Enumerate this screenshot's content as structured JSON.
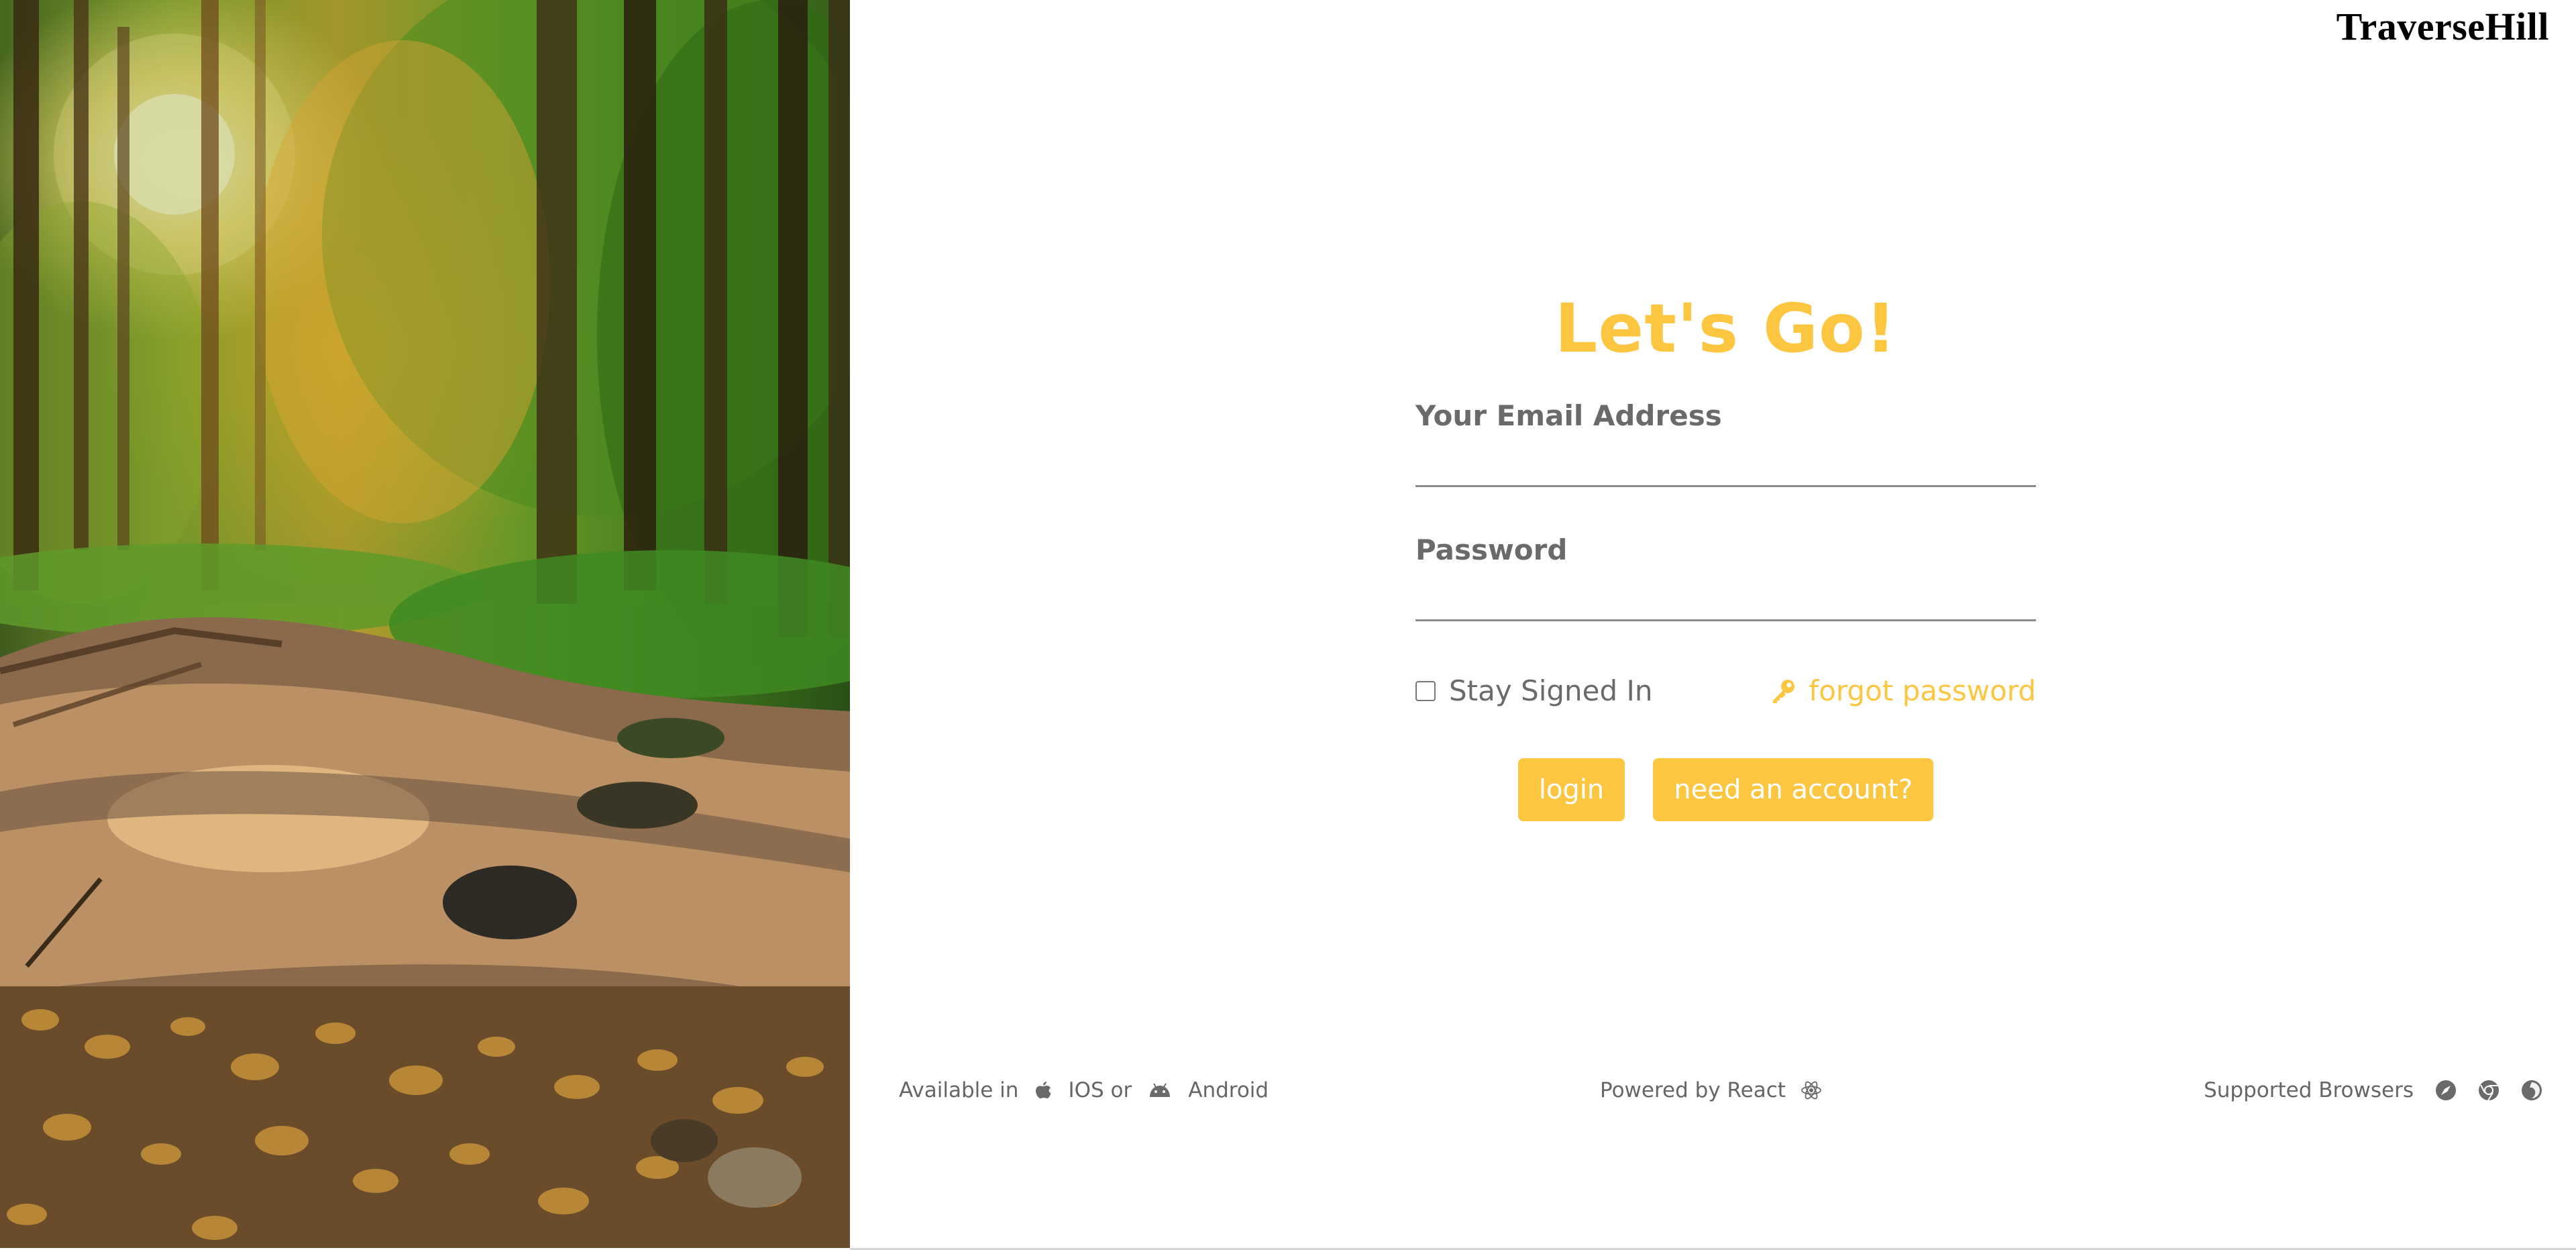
{
  "brand": {
    "name": "TraverseHill"
  },
  "login": {
    "title": "Let's Go!",
    "email_label": "Your Email Address",
    "email_value": "",
    "password_label": "Password",
    "password_value": "",
    "stay_signed_in_label": "Stay Signed In",
    "stay_signed_in_checked": false,
    "forgot_password_label": "forgot password",
    "forgot_password_icon": "key-icon",
    "login_button_label": "login",
    "signup_button_label": "need an account?"
  },
  "footer": {
    "available_in_label": "Available in",
    "ios_icon": "apple-icon",
    "ios_label": "IOS or",
    "android_icon": "android-icon",
    "android_label": "Android",
    "powered_by_label": "Powered by React",
    "react_icon": "react-icon",
    "supported_browsers_label": "Supported Browsers",
    "browser_icons": [
      "safari-icon",
      "chrome-icon",
      "firefox-icon"
    ]
  },
  "colors": {
    "accent": "#fdc641",
    "text_muted": "#6a6a6a",
    "footer_text": "#666666"
  }
}
